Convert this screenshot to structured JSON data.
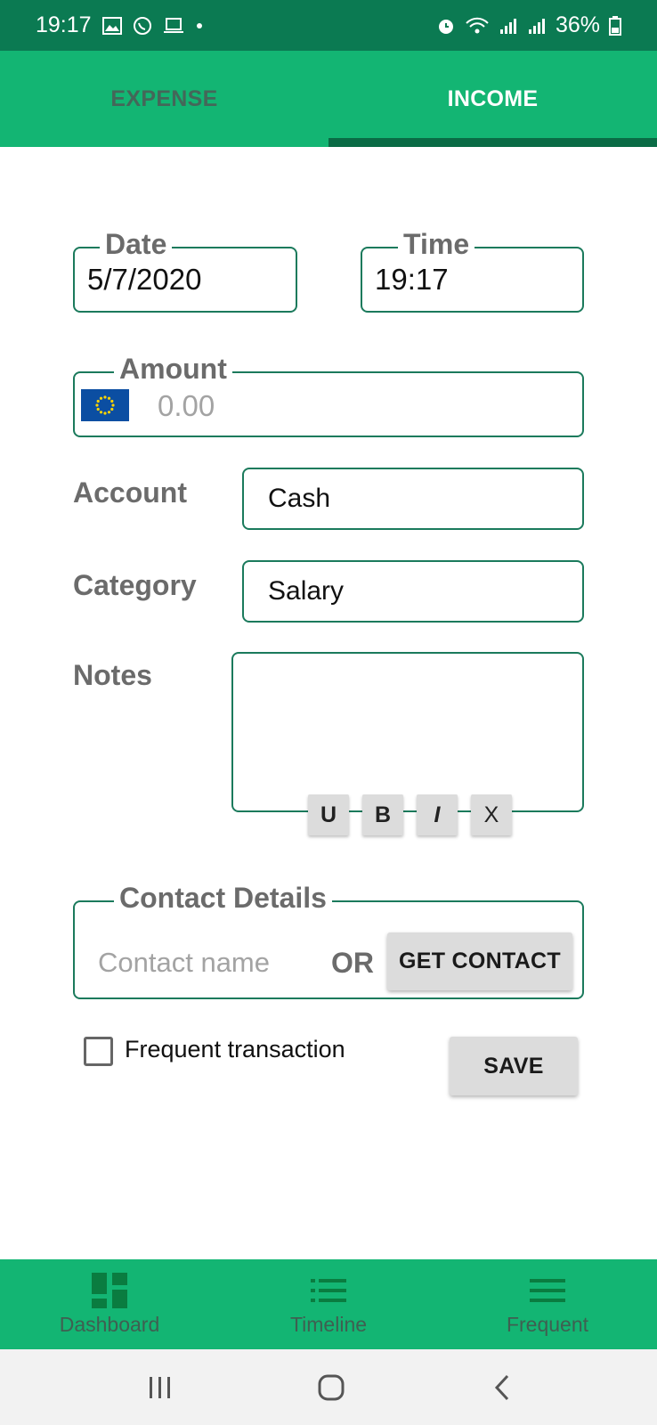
{
  "status_bar": {
    "time": "19:17",
    "battery": "36%",
    "left_icons": [
      "image-icon",
      "whatsapp-icon",
      "laptop-icon",
      "dot-icon"
    ],
    "right_icons": [
      "alarm-icon",
      "wifi-icon",
      "signal-icon",
      "signal-r-icon",
      "battery-icon"
    ]
  },
  "tabs": [
    {
      "label": "EXPENSE",
      "selected": false
    },
    {
      "label": "INCOME",
      "selected": true
    }
  ],
  "form": {
    "date": {
      "label": "Date",
      "value": "5/7/2020"
    },
    "time": {
      "label": "Time",
      "value": "19:17"
    },
    "amount": {
      "label": "Amount",
      "placeholder": "0.00",
      "currency_icon": "eu-flag-icon"
    },
    "account": {
      "label": "Account",
      "value": "Cash"
    },
    "category": {
      "label": "Category",
      "value": "Salary"
    },
    "notes": {
      "label": "Notes",
      "value": ""
    },
    "format_buttons": [
      "U",
      "B",
      "I",
      "X"
    ],
    "contact": {
      "label": "Contact Details",
      "placeholder": "Contact name",
      "or_text": "OR",
      "get_contact_label": "GET CONTACT"
    },
    "frequent": {
      "label": "Frequent transaction",
      "checked": false
    },
    "save_label": "SAVE"
  },
  "bottom_nav": [
    {
      "label": "Dashboard",
      "icon": "dashboard-icon"
    },
    {
      "label": "Timeline",
      "icon": "list-icon"
    },
    {
      "label": "Frequent",
      "icon": "menu-icon"
    }
  ],
  "system_nav": [
    "recent-apps-icon",
    "home-icon",
    "back-icon"
  ],
  "colors": {
    "status_bar": "#0b7a52",
    "primary": "#13b573",
    "indicator": "#0a6b45",
    "field_border": "#1b7a5c"
  }
}
